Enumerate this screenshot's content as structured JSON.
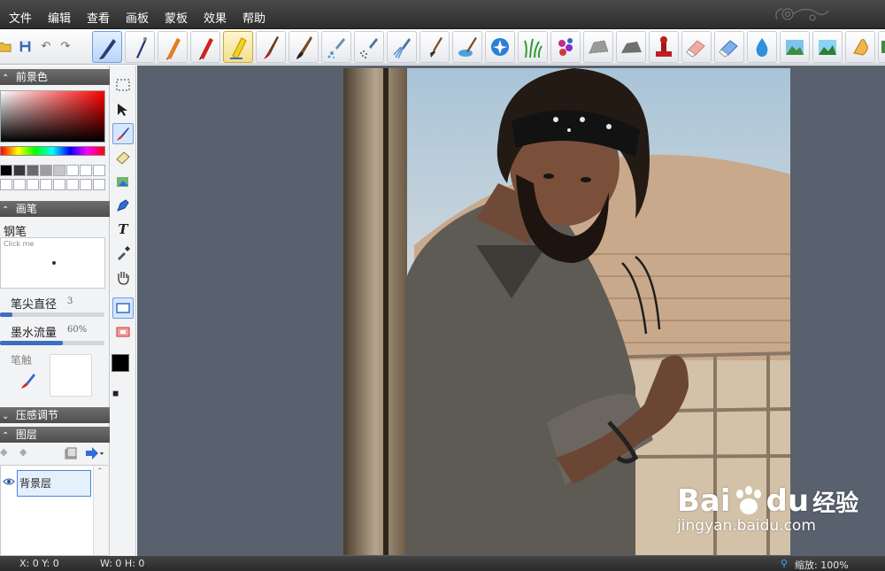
{
  "menu": [
    "文件",
    "编辑",
    "查看",
    "画板",
    "蒙板",
    "效果",
    "帮助"
  ],
  "toolbar": {
    "icons": [
      "open-folder-icon",
      "save-icon",
      "undo-icon",
      "redo-icon"
    ],
    "brushes": [
      "calligraphy-pen",
      "fine-pen",
      "crayon",
      "red-crayon",
      "highlighter",
      "paint-brush",
      "oil-brush",
      "airbrush",
      "spray",
      "fan-brush",
      "flat-brush",
      "palette-knife",
      "magic-wand",
      "grass-brush",
      "flower-brush",
      "texture-brush",
      "smudge-brush",
      "stamp",
      "eraser",
      "blue-eraser",
      "water-drop",
      "landscape-1",
      "landscape-2",
      "finger-smudge"
    ]
  },
  "panels": {
    "foreground": "前景色",
    "brush": "画笔",
    "pressure": "压感调节",
    "layers": "图层"
  },
  "brush": {
    "name": "钢笔",
    "preview_hint": "Click me",
    "tip_diameter_label": "笔尖直径",
    "tip_diameter_value": "3",
    "tip_diameter_fraction": 0.12,
    "flow_label": "墨水流量",
    "flow_value": "60%",
    "flow_fraction": 0.6,
    "tip_label": "笔触"
  },
  "swatches": [
    "#000000",
    "#3a3a3a",
    "#6b6b6b",
    "#9e9e9e",
    "#c6c6c6",
    "#ffffff",
    "#ffffff",
    "#ffffff",
    "#ffffff",
    "#ffffff",
    "#ffffff",
    "#ffffff",
    "#ffffff",
    "#ffffff",
    "#ffffff",
    "#ffffff"
  ],
  "layers": [
    {
      "name": "背景层",
      "visible": true
    }
  ],
  "status": {
    "coords": "X: 0 Y: 0",
    "size": "W: 0 H: 0",
    "zoom": "缩放: 100%"
  },
  "watermark": {
    "brand": "Bai",
    "brand2": "du",
    "cn": "经验",
    "url": "jingyan.baidu.com"
  },
  "colors": {
    "accent": "#3b6ec2",
    "panel_header": "#5a5a5a",
    "canvas_bg": "#59616e"
  }
}
